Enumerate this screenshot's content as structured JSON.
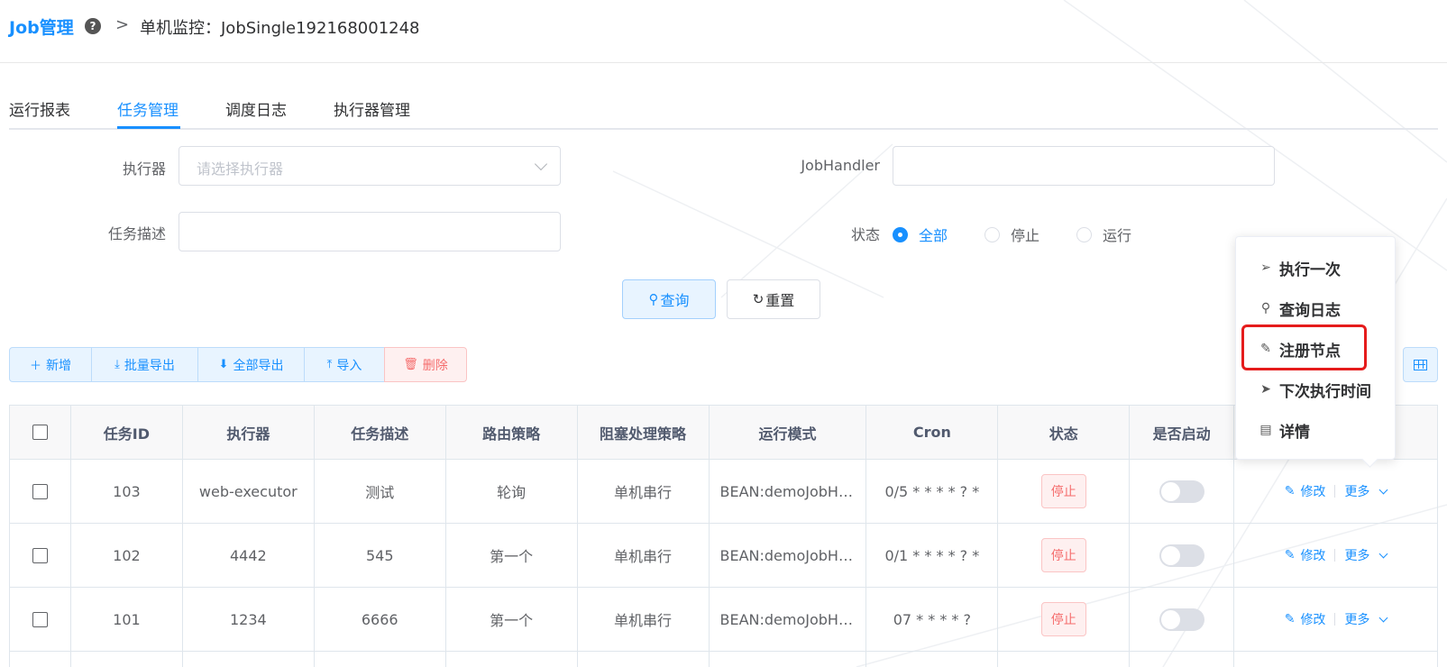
{
  "header": {
    "brand": "Job管理",
    "help_icon": "?",
    "separator": ">",
    "breadcrumb_title": "单机监控：JobSingle192168001248"
  },
  "tabs": [
    "运行报表",
    "任务管理",
    "调度日志",
    "执行器管理"
  ],
  "active_tab": "任务管理",
  "form": {
    "executor_label": "执行器",
    "executor_placeholder": "请选择执行器",
    "jobhandler_label": "JobHandler",
    "jobhandler_value": "",
    "desc_label": "任务描述",
    "desc_value": "",
    "status_label": "状态",
    "status_options": [
      "全部",
      "停止",
      "运行"
    ],
    "status_selected": "全部",
    "query_label": "查询",
    "reset_label": "重置"
  },
  "toolbar": {
    "add_label": "新增",
    "batch_export_label": "批量导出",
    "export_all_label": "全部导出",
    "import_label": "导入",
    "delete_label": "删除"
  },
  "table": {
    "columns": [
      "任务ID",
      "执行器",
      "任务描述",
      "路由策略",
      "阻塞处理策略",
      "运行模式",
      "Cron",
      "状态",
      "是否启动",
      ""
    ],
    "rows": [
      {
        "id": "103",
        "executor": "web-executor",
        "desc": "测试",
        "route": "轮询",
        "block": "单机串行",
        "mode": "BEAN:demoJobHandler",
        "cron": "0/5 * * * * ? *",
        "status": "停止",
        "enabled": false
      },
      {
        "id": "102",
        "executor": "4442",
        "desc": "545",
        "route": "第一个",
        "block": "单机串行",
        "mode": "BEAN:demoJobHandler",
        "cron": "0/1 * * * * ? *",
        "status": "停止",
        "enabled": false
      },
      {
        "id": "101",
        "executor": "1234",
        "desc": "6666",
        "route": "第一个",
        "block": "单机串行",
        "mode": "BEAN:demoJobHandler",
        "cron": "07 * * * * ?",
        "status": "停止",
        "enabled": false
      }
    ],
    "edit_label": "修改",
    "more_label": "更多"
  },
  "dropdown": {
    "items": [
      {
        "label": "执行一次",
        "icon": "send-outline-icon"
      },
      {
        "label": "查询日志",
        "icon": "search-icon"
      },
      {
        "label": "注册节点",
        "icon": "edit-icon"
      },
      {
        "label": "下次执行时间",
        "icon": "send-filled-icon"
      },
      {
        "label": "详情",
        "icon": "document-icon"
      }
    ],
    "highlighted": "注册节点"
  },
  "colors": {
    "primary": "#1890ff",
    "danger": "#f56c6c",
    "highlight": "#e51c1c"
  }
}
